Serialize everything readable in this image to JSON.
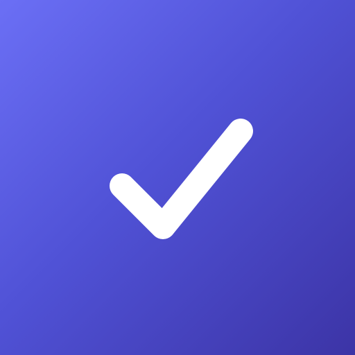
{
  "icon": {
    "name": "checkmark-icon",
    "color": "#FFFFFF"
  },
  "background": {
    "gradient_start": "#6B6FF5",
    "gradient_mid": "#5052D6",
    "gradient_end": "#3C34A6"
  }
}
